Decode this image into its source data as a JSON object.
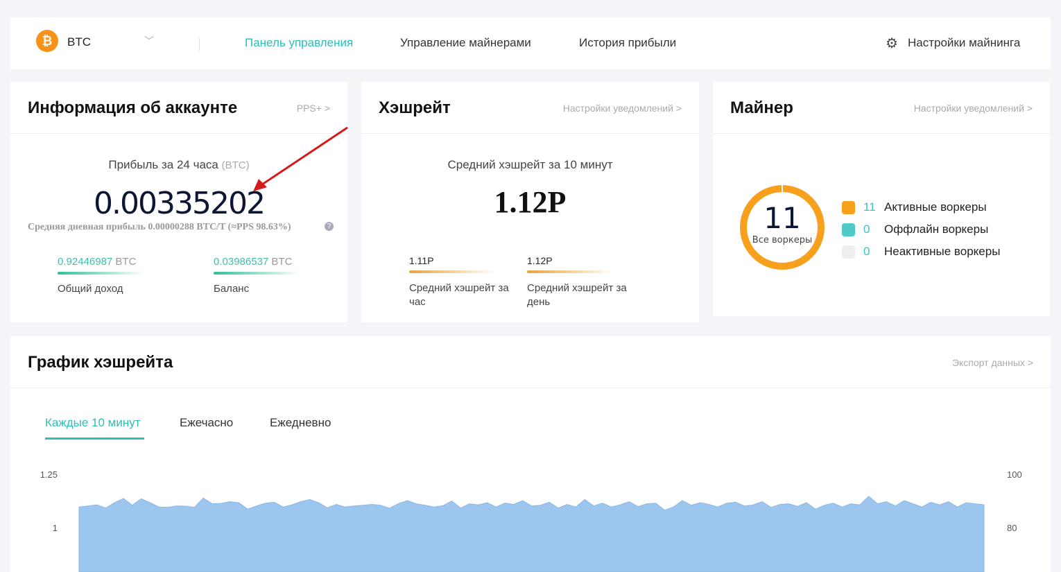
{
  "header": {
    "coin": "BTC",
    "coin_icon": "₿",
    "nav": [
      "Панель управления",
      "Управление майнерами",
      "История прибыли"
    ],
    "settings": "Настройки майнинга"
  },
  "account": {
    "title": "Информация об аккаунте",
    "link": "PPS+ >",
    "profit_label": "Прибыль за 24 часа",
    "profit_unit": "(BTC)",
    "profit": "0.00335202",
    "avg": "Средняя дневная прибыль 0.00000288 BTC/T (≈PPS 98.63%)",
    "total_value": "0.92446987",
    "total_unit": "BTC",
    "total_label": "Общий доход",
    "balance_value": "0.03986537",
    "balance_unit": "BTC",
    "balance_label": "Баланс"
  },
  "hashrate": {
    "title": "Хэшрейт",
    "link": "Настройки уведомлений >",
    "avg10_label": "Средний хэшрейт за 10 минут",
    "avg10": "1.12P",
    "hour_value": "1.11P",
    "hour_label": "Средний хэшрейт за час",
    "day_value": "1.12P",
    "day_label": "Средний хэшрейт за день"
  },
  "miner": {
    "title": "Майнер",
    "link": "Настройки уведомлений >",
    "total": "11",
    "total_label": "Все воркеры",
    "legend": [
      {
        "count": "11",
        "label": "Активные воркеры",
        "color": "#f7a01d"
      },
      {
        "count": "0",
        "label": "Оффлайн воркеры",
        "color": "#4fc9c9"
      },
      {
        "count": "0",
        "label": "Неактивные воркеры",
        "color": "#eeeeee"
      }
    ]
  },
  "chart": {
    "title": "График хэшрейта",
    "link": "Экспорт данных >",
    "tabs": [
      "Каждые 10 минут",
      "Ежечасно",
      "Ежедневно"
    ]
  },
  "chart_data": {
    "type": "area",
    "ylim_left": [
      0,
      1.25
    ],
    "ylim_right": [
      0,
      100
    ],
    "left_ticks": [
      "1.25",
      "1"
    ],
    "right_ticks": [
      "100",
      "80"
    ],
    "color": "#9dc6ee",
    "values": [
      1.1,
      1.105,
      1.11,
      1.095,
      1.12,
      1.14,
      1.108,
      1.138,
      1.12,
      1.1,
      1.098,
      1.105,
      1.104,
      1.098,
      1.142,
      1.115,
      1.117,
      1.125,
      1.12,
      1.09,
      1.105,
      1.118,
      1.122,
      1.1,
      1.11,
      1.125,
      1.135,
      1.12,
      1.096,
      1.112,
      1.1,
      1.105,
      1.108,
      1.112,
      1.108,
      1.094,
      1.116,
      1.13,
      1.115,
      1.108,
      1.1,
      1.106,
      1.128,
      1.095,
      1.115,
      1.11,
      1.12,
      1.1,
      1.118,
      1.112,
      1.13,
      1.105,
      1.108,
      1.122,
      1.095,
      1.112,
      1.1,
      1.135,
      1.105,
      1.118,
      1.1,
      1.11,
      1.125,
      1.102,
      1.115,
      1.118,
      1.085,
      1.1,
      1.13,
      1.108,
      1.12,
      1.112,
      1.1,
      1.118,
      1.122,
      1.105,
      1.11,
      1.125,
      1.098,
      1.112,
      1.115,
      1.103,
      1.12,
      1.09,
      1.108,
      1.118,
      1.1,
      1.115,
      1.11,
      1.15,
      1.115,
      1.125,
      1.105,
      1.13,
      1.115,
      1.1,
      1.122,
      1.11,
      1.125,
      1.1,
      1.12,
      1.115,
      1.11
    ]
  }
}
